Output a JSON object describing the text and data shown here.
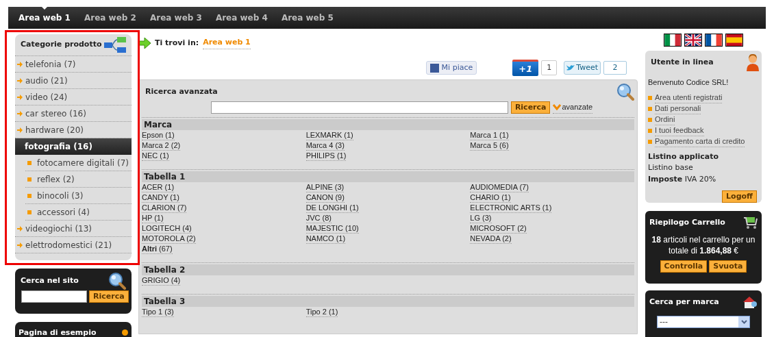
{
  "nav": {
    "tabs": [
      {
        "label": "Area web 1",
        "selected": true
      },
      {
        "label": "Area web 2",
        "selected": false
      },
      {
        "label": "Area web 3",
        "selected": false
      },
      {
        "label": "Area web 4",
        "selected": false
      },
      {
        "label": "Area web 5",
        "selected": false
      }
    ]
  },
  "categories": {
    "title": "Categorie prodotto",
    "items": [
      {
        "label": "telefonia (7)",
        "selected": false
      },
      {
        "label": "audio (21)",
        "selected": false
      },
      {
        "label": "video (24)",
        "selected": false
      },
      {
        "label": "car stereo (16)",
        "selected": false
      },
      {
        "label": "hardware (20)",
        "selected": false
      },
      {
        "label": "fotografia (16)",
        "selected": true,
        "children": [
          {
            "label": "fotocamere digitali (7)"
          },
          {
            "label": "reflex (2)"
          },
          {
            "label": "binocoli (3)"
          },
          {
            "label": "accessori (4)"
          }
        ]
      },
      {
        "label": "videogiochi (13)",
        "selected": false
      },
      {
        "label": "elettrodomestici (21)",
        "selected": false
      }
    ]
  },
  "site_search": {
    "title": "Cerca nel sito",
    "button": "Ricerca"
  },
  "sample_page": {
    "title": "Pagina di esempio"
  },
  "breadcrumb": {
    "prefix": "Ti trovi in:",
    "link": "Area web 1"
  },
  "social": {
    "like": "Mi piace",
    "plus_one": "+1",
    "plus_one_count": "1",
    "tweet": "Tweet",
    "tweet_count": "2"
  },
  "advanced_search": {
    "title": "Ricerca avanzata",
    "button": "Ricerca",
    "toggle": "avanzate",
    "sections": [
      {
        "title": "Marca",
        "items": [
          "Epson (1)",
          "LEXMARK (1)",
          "Marca 1 (1)",
          "Marca 2 (2)",
          "Marca 4 (3)",
          "Marca 5 (6)",
          "NEC (1)",
          "PHILIPS (1)"
        ]
      },
      {
        "title": "Tabella 1",
        "items": [
          "ACER (1)",
          "ALPINE (3)",
          "AUDIOMEDIA (7)",
          "CANDY (1)",
          "CANON (9)",
          "CHARIO (1)",
          "CLARION (7)",
          "DE LONGHI (1)",
          "ELECTRONIC ARTS (1)",
          "HP (1)",
          "JVC (8)",
          "LG (3)",
          "LOGITECH (4)",
          "MAJESTIC (10)",
          "MICROSOFT (2)",
          "MOTOROLA (2)",
          "NAMCO (1)",
          "NEVADA (2)",
          "**Altri** (67)"
        ]
      },
      {
        "title": "Tabella 2",
        "items": [
          "GRIGIO (4)"
        ]
      },
      {
        "title": "Tabella 3",
        "items": [
          "Tipo 1 (3)",
          "Tipo 2 (1)"
        ]
      }
    ]
  },
  "user": {
    "title": "Utente in linea",
    "welcome": "Benvenuto Codice SRL!",
    "links": [
      "Area utenti registrati",
      "Dati personali",
      "Ordini",
      "I tuoi feedback",
      "Pagamento carta di credito"
    ],
    "price_list_label": "Listino applicato",
    "price_list": "Listino base",
    "taxes": "**Imposte** IVA 20%",
    "button": "Logoff"
  },
  "cart": {
    "title": "Riepilogo Carrello",
    "summary": "**18** articoli nel carrello per un totale di **1.864,88** €",
    "buttons": [
      "Controlla",
      "Svuota"
    ]
  },
  "brand_search": {
    "title": "Cerca per marca",
    "value": "---"
  }
}
